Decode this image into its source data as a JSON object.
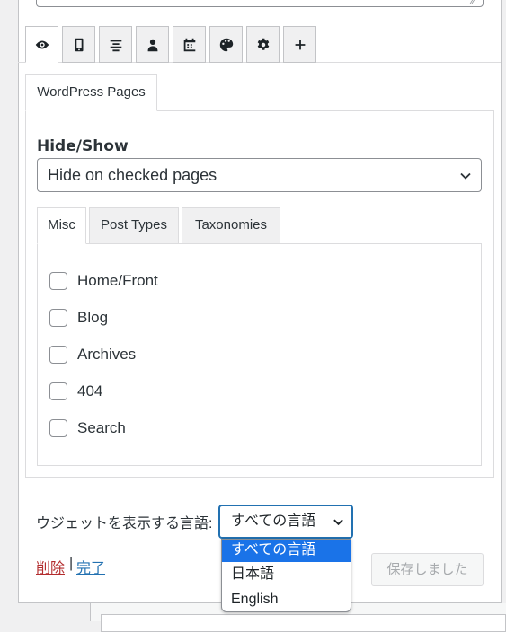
{
  "icon_tabs": [
    {
      "icon": "eye-icon",
      "active": true
    },
    {
      "icon": "mobile-icon",
      "active": false
    },
    {
      "icon": "align-center-icon",
      "active": false
    },
    {
      "icon": "user-icon",
      "active": false
    },
    {
      "icon": "calendar-icon",
      "active": false
    },
    {
      "icon": "palette-icon",
      "active": false
    },
    {
      "icon": "gear-icon",
      "active": false
    },
    {
      "icon": "plus-icon",
      "active": false
    }
  ],
  "wordpress_pages": {
    "tab_label": "WordPress Pages",
    "hide_show_label": "Hide/Show",
    "hide_show_value": "Hide on checked pages",
    "inner_tabs": [
      "Misc",
      "Post Types",
      "Taxonomies"
    ],
    "checkboxes": [
      "Home/Front",
      "Blog",
      "Archives",
      "404",
      "Search"
    ]
  },
  "language": {
    "label": "ウジェットを表示する言語:",
    "selected": "すべての言語",
    "options": [
      "すべての言語",
      "日本語",
      "English"
    ]
  },
  "footer": {
    "delete_label": "削除",
    "separator": "|",
    "done_label": "完了",
    "save_label": "保存しました"
  },
  "colors": {
    "accent": "#2271b1",
    "delete": "#b32d2e",
    "dropdown_highlight": "#1a73e8"
  }
}
